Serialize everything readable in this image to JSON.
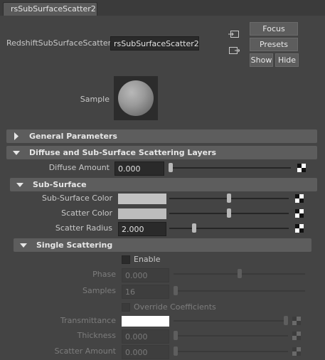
{
  "tab": {
    "label": "rsSubSurfaceScatter2"
  },
  "node": {
    "type_label": "RedshiftSubSurfaceScatter:",
    "name": "rsSubSurfaceScatter2"
  },
  "buttons": {
    "focus": "Focus",
    "presets": "Presets",
    "show": "Show",
    "hide": "Hide"
  },
  "sample": {
    "label": "Sample"
  },
  "sections": {
    "general": "General Parameters",
    "diffuse_layers": "Diffuse and Sub-Surface Scattering Layers",
    "sub_surface": "Sub-Surface",
    "single_scattering": "Single Scattering"
  },
  "attributes": {
    "diffuse_amount": {
      "label": "Diffuse Amount",
      "value": "0.000",
      "slider": 0.0
    },
    "sub_surface_color": {
      "label": "Sub-Surface Color",
      "color": "#c2c2c2",
      "slider": 0.5
    },
    "scatter_color": {
      "label": "Scatter Color",
      "color": "#bcbcbc",
      "slider": 0.5
    },
    "scatter_radius": {
      "label": "Scatter Radius",
      "value": "2.000",
      "slider": 0.2
    },
    "enable": {
      "label": "Enable",
      "checked": false
    },
    "phase": {
      "label": "Phase",
      "value": "0.000",
      "slider": 0.5
    },
    "samples": {
      "label": "Samples",
      "value": "16",
      "slider": 0.0
    },
    "override_coefficients": {
      "label": "Override Coefficients",
      "checked": false
    },
    "transmittance": {
      "label": "Transmittance",
      "color": "#ffffff",
      "slider": 1.0
    },
    "thickness": {
      "label": "Thickness",
      "value": "0.000",
      "slider": 0.0
    },
    "scatter_amount": {
      "label": "Scatter Amount",
      "value": "0.000",
      "slider": 0.0
    }
  },
  "colors": {
    "background": "#444444",
    "frame_header": "#5d5d5d",
    "field_bg": "#2a2a2a",
    "slider_thumb": "#b8b8b8"
  }
}
